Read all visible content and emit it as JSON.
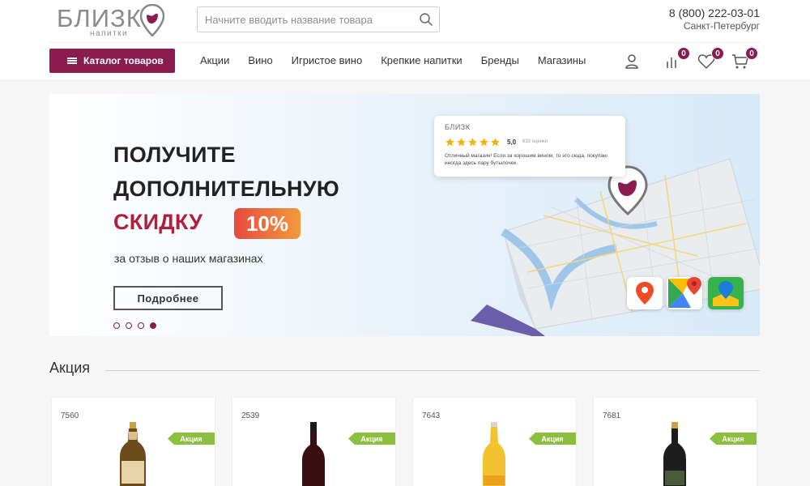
{
  "header": {
    "logo_text": "БЛИЗК",
    "logo_sub": "напитки",
    "search_placeholder": "Начните вводить название товара",
    "phone": "8 (800) 222-03-01",
    "city": "Санкт-Петербург"
  },
  "nav": {
    "catalog_label": "Каталог товаров",
    "items": [
      "Акции",
      "Вино",
      "Игристое вино",
      "Крепкие напитки",
      "Бренды",
      "Магазины"
    ],
    "compare_count": "0",
    "favorites_count": "0",
    "cart_count": "0"
  },
  "banner": {
    "line1": "ПОЛУЧИТЕ",
    "line2": "ДОПОЛНИТЕЛЬНУЮ",
    "line3": "СКИДКУ",
    "discount": "10%",
    "subtitle": "за отзыв о наших магазинах",
    "button_label": "Подробнее",
    "slide_count": 4,
    "active_slide": 4,
    "review": {
      "brand": "БЛИЗК",
      "rating": "5,0",
      "count": "633 оценки",
      "text": "Отличный магазин! Если за хорошим вином, то это сюда, покупаю иногда здесь пару бутылочек."
    }
  },
  "section": {
    "title": "Акция"
  },
  "products": [
    {
      "code": "7560",
      "tag": "Акция",
      "bottle": "beer-brown"
    },
    {
      "code": "2539",
      "tag": "Акция",
      "bottle": "wine-dark"
    },
    {
      "code": "7643",
      "tag": "Акция",
      "bottle": "beer-clear"
    },
    {
      "code": "7681",
      "tag": "Акция",
      "bottle": "beer-dark"
    }
  ],
  "colors": {
    "brand": "#8b1c4f",
    "tag_green": "#8cbf3f"
  }
}
